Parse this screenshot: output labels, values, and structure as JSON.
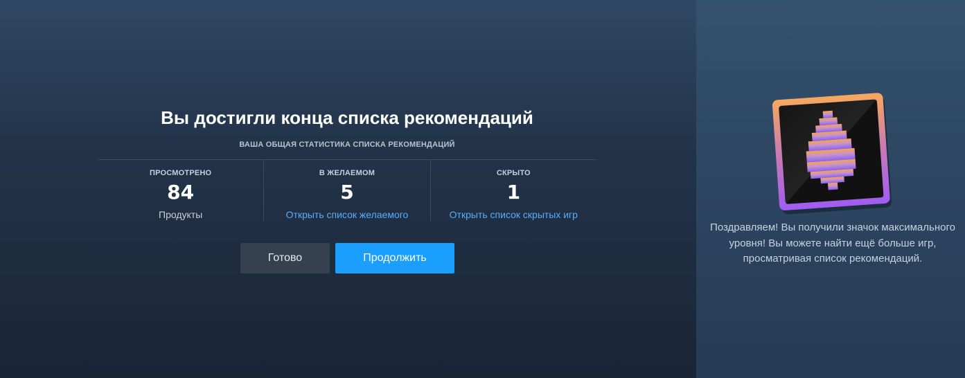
{
  "main": {
    "title": "Вы достигли конца списка рекомендаций",
    "subtitle": "ВАША ОБЩАЯ СТАТИСТИКА СПИСКА РЕКОМЕНДАЦИЙ",
    "stats": [
      {
        "label": "ПРОСМОТРЕНО",
        "value": "84",
        "sub": "Продукты"
      },
      {
        "label": "В ЖЕЛАЕМОМ",
        "value": "5",
        "link": "Открыть список желаемого"
      },
      {
        "label": "СКРЫТО",
        "value": "1",
        "link": "Открыть список скрытых игр"
      }
    ],
    "buttons": {
      "done": "Готово",
      "continue": "Продолжить"
    }
  },
  "side": {
    "badge_icon": "queue-badge-icon",
    "message": "Поздравляем! Вы получили значок максимального уровня! Вы можете найти ещё больше игр, просматривая список рекомендаций."
  },
  "colors": {
    "accent": "#1a9fff",
    "link": "#57aefc",
    "badge_frame_top": "#f7a85e",
    "badge_frame_bottom": "#a05cf2"
  }
}
